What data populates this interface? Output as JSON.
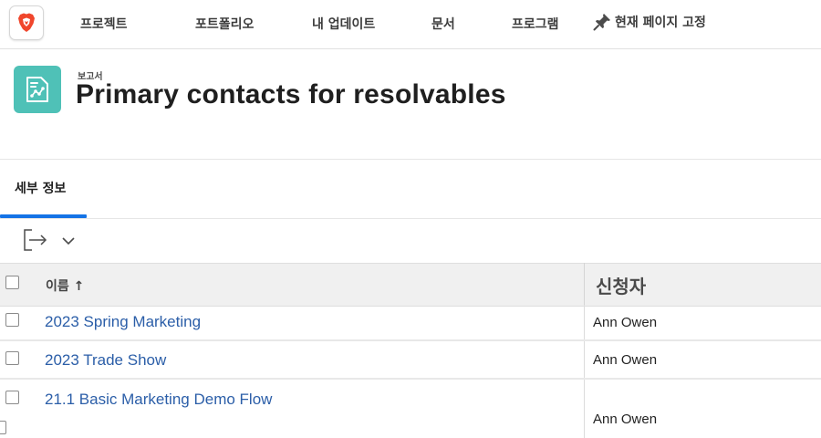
{
  "nav": {
    "items": [
      "프로젝트",
      "포트폴리오",
      "내 업데이트",
      "문서",
      "프로그램"
    ],
    "pin_label": "현재 페이지 고정"
  },
  "header": {
    "object_type": "보고서",
    "title": "Primary contacts for resolvables"
  },
  "tabs": [
    {
      "label": "세부 정보",
      "active": true
    }
  ],
  "table": {
    "columns": {
      "name": "이름 ↑",
      "requestor": "신청자"
    },
    "rows": [
      {
        "name": "2023 Spring Marketing",
        "requestor": "Ann Owen"
      },
      {
        "name": "2023 Trade Show",
        "requestor": "Ann Owen"
      },
      {
        "name": "21.1 Basic Marketing Demo Flow",
        "requestor": "Ann Owen"
      }
    ]
  },
  "icons": {
    "brand": "lion-logo-icon",
    "pin": "pushpin-icon",
    "report": "report-icon",
    "export": "export-icon",
    "chevron": "chevron-down-icon"
  },
  "colors": {
    "accent": "#1473e6",
    "link": "#2b5ea8",
    "report_icon_bg": "#4fc1b7",
    "brand_orange": "#f0462c"
  }
}
